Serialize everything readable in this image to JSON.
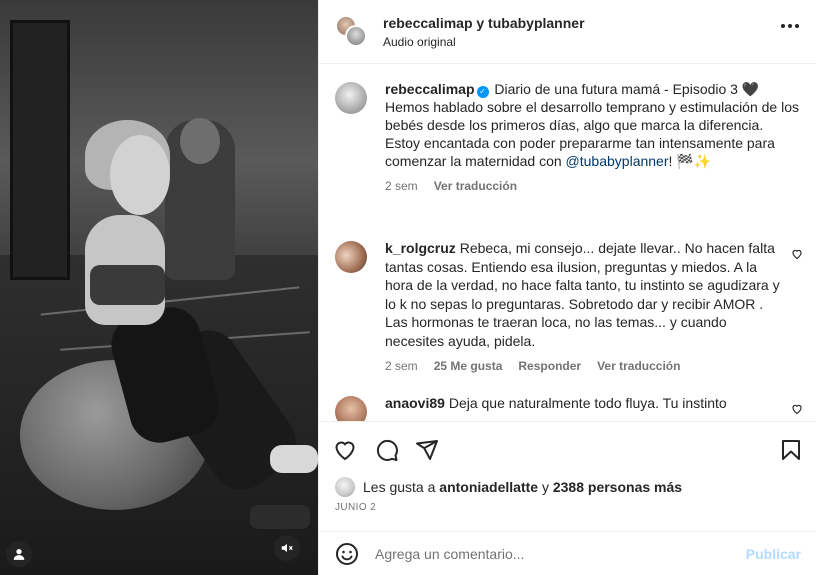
{
  "header": {
    "title": "rebeccalimap y tubabyplanner",
    "subtitle": "Audio original"
  },
  "caption": {
    "username": "rebeccalimap",
    "text_before_mention": "Diario de una futura mamá - Episodio 3 🖤\nHemos hablado sobre el desarrollo temprano y estimulación de los bebés desde los primeros días, algo que marca la diferencia.\nEstoy encantada con poder prepararme tan intensamente para comenzar la maternidad con ",
    "mention": "@tubabyplanner",
    "text_after_mention": "! 🏁✨",
    "time": "2 sem",
    "translate": "Ver traducción"
  },
  "comments": [
    {
      "username": "k_rolgcruz",
      "text": "Rebeca, mi consejo... dejate llevar.. No hacen falta tantas cosas. Entiendo esa ilusion, preguntas y miedos. A la hora de la verdad, no hace falta tanto, tu instinto se agudizara y lo k no sepas lo preguntaras. Sobretodo dar y recibir AMOR . Las hormonas te traeran loca, no las temas... y cuando necesites ayuda, pidela.",
      "time": "2 sem",
      "likes": "25 Me gusta",
      "reply": "Responder",
      "translate": "Ver traducción"
    },
    {
      "username": "anaovi89",
      "text": "Deja que naturalmente todo fluya. Tu instinto"
    }
  ],
  "likes": {
    "prefix": "Les gusta a",
    "user": "antoniadellatte",
    "connector": "y",
    "count": "2388 personas más"
  },
  "date": "JUNIO 2",
  "add_comment": {
    "placeholder": "Agrega un comentario...",
    "post_label": "Publicar",
    "post_color": "#b3dbff"
  },
  "icons": {
    "like": "heart-icon",
    "comment": "comment-icon",
    "share": "send-icon",
    "save": "bookmark-icon",
    "emoji": "emoji-icon",
    "more": "more-icon",
    "audio": "speaker-muted-icon",
    "tag": "user-tag-icon"
  }
}
